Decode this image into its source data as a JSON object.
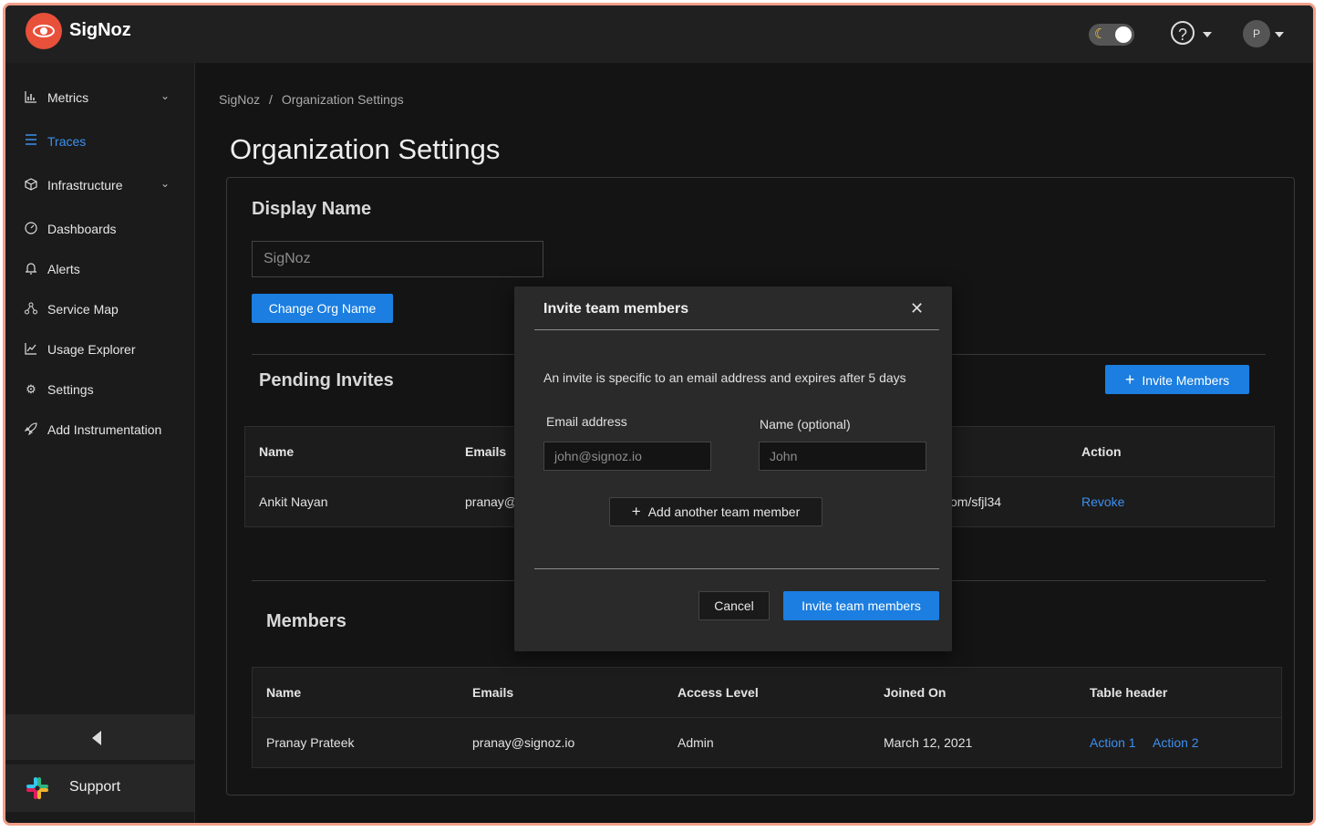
{
  "app": {
    "name": "SigNoz"
  },
  "header": {
    "avatar_initial": "P",
    "help_glyph": "?",
    "theme_icon": "moon-icon"
  },
  "sidebar": {
    "items": [
      {
        "label": "Metrics",
        "icon": "bar-chart-icon",
        "expandable": true
      },
      {
        "label": "Traces",
        "icon": "menu-icon",
        "active": true
      },
      {
        "label": "Infrastructure",
        "icon": "cube-icon",
        "expandable": true
      },
      {
        "label": "Dashboards",
        "icon": "dashboard-icon"
      },
      {
        "label": "Alerts",
        "icon": "bell-icon"
      },
      {
        "label": "Service Map",
        "icon": "network-icon"
      },
      {
        "label": "Usage Explorer",
        "icon": "line-chart-icon"
      },
      {
        "label": "Settings",
        "icon": "gear-icon"
      },
      {
        "label": "Add Instrumentation",
        "icon": "rocket-icon"
      }
    ],
    "support_label": "Support"
  },
  "breadcrumb": {
    "root": "SigNoz",
    "separator": "/",
    "current": "Organization Settings"
  },
  "page_title": "Organization Settings",
  "display_name": {
    "title": "Display Name",
    "input_value": "SigNoz",
    "button_label": "Change Org Name"
  },
  "pending_invites": {
    "title": "Pending Invites",
    "invite_button": "Invite Members",
    "columns": [
      "Name",
      "Emails",
      "Action"
    ],
    "rows": [
      {
        "name": "Ankit Nayan",
        "email_partial": "pranay@",
        "link_partial": "om/sfjl34",
        "action": "Revoke"
      }
    ]
  },
  "members": {
    "title": "Members",
    "columns": [
      "Name",
      "Emails",
      "Access Level",
      "Joined On",
      "Table header"
    ],
    "rows": [
      {
        "name": "Pranay Prateek",
        "email": "pranay@signoz.io",
        "access": "Admin",
        "joined": "March 12, 2021",
        "action1": "Action 1",
        "action2": "Action 2"
      }
    ]
  },
  "modal": {
    "title": "Invite team members",
    "description": "An invite is specific to an email address and expires after 5 days",
    "email_label": "Email address",
    "email_placeholder": "john@signoz.io",
    "name_label": "Name (optional)",
    "name_placeholder": "John",
    "add_another": "Add another team member",
    "cancel": "Cancel",
    "submit": "Invite team members"
  },
  "colors": {
    "accent": "#1b7ee0",
    "brand": "#e8503a",
    "link": "#3d8fef"
  }
}
